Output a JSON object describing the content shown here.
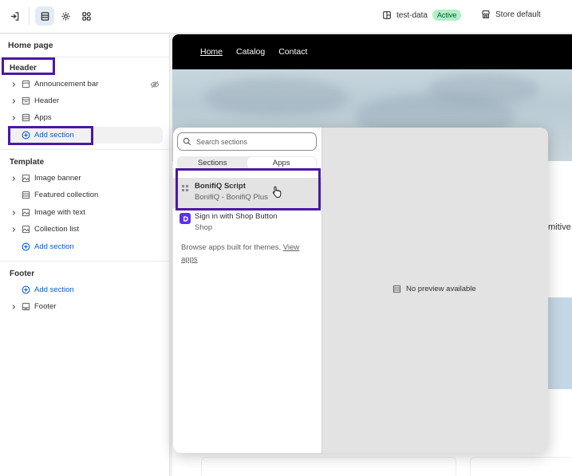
{
  "topbar": {
    "theme_name": "test-data",
    "theme_status": "Active",
    "store_label": "Store default"
  },
  "sidebar": {
    "title": "Home page",
    "header": {
      "label": "Header",
      "items": [
        {
          "label": "Announcement bar"
        },
        {
          "label": "Header"
        },
        {
          "label": "Apps"
        }
      ],
      "add_label": "Add section"
    },
    "template": {
      "label": "Template",
      "items": [
        {
          "label": "Image banner"
        },
        {
          "label": "Featured collection"
        },
        {
          "label": "Image with text"
        },
        {
          "label": "Collection list"
        }
      ],
      "add_label": "Add section"
    },
    "footer": {
      "label": "Footer",
      "add_label": "Add section",
      "items": [
        {
          "label": "Footer"
        }
      ]
    }
  },
  "preview": {
    "nav": [
      "Home",
      "Catalog",
      "Contact"
    ],
    "side_text": "mitive"
  },
  "picker": {
    "search_placeholder": "Search sections",
    "tabs": [
      "Sections",
      "Apps"
    ],
    "apps": [
      {
        "name": "BonifiQ Script",
        "provider": "BonifiQ - BonifiQ Plus"
      },
      {
        "name": "Sign in with Shop Button",
        "provider": "Shop"
      }
    ],
    "browse_text": "Browse apps built for themes.",
    "browse_link": "View apps",
    "no_preview": "No preview available"
  },
  "colors": {
    "accent": "#005bd3",
    "highlight_box": "#4b18a6",
    "active_badge": "#aff0c6"
  }
}
